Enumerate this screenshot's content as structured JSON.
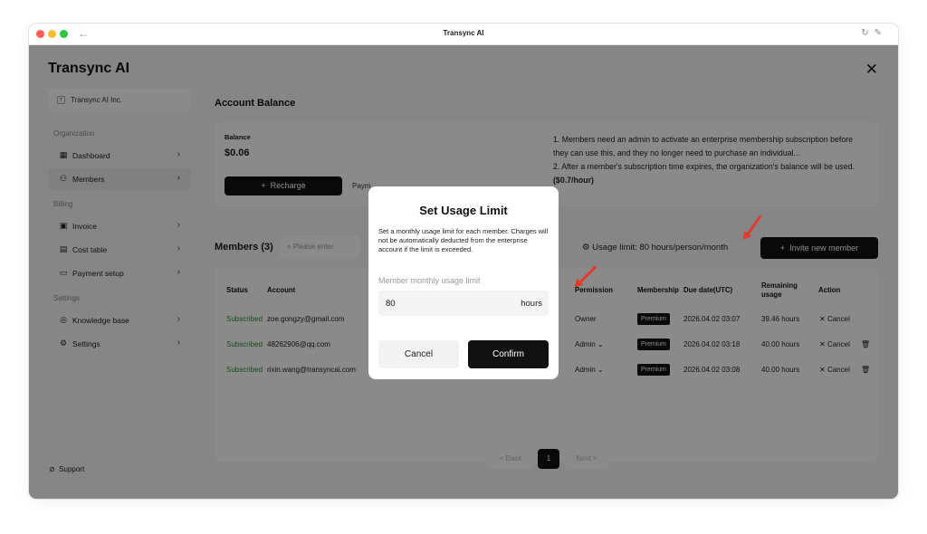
{
  "window": {
    "title": "Transync AI"
  },
  "sidebar": {
    "brand": "Transync AI",
    "org_switcher": {
      "initial": "T",
      "name": "Transync AI Inc."
    },
    "sections": {
      "organization": "Organization",
      "billing": "Billing",
      "settings": "Settings"
    },
    "items": [
      {
        "label": "Dashboard",
        "icon": "dashboard-icon"
      },
      {
        "label": "Members",
        "icon": "members-icon"
      },
      {
        "label": "Invoice",
        "icon": "invoice-icon"
      },
      {
        "label": "Cost table",
        "icon": "calendar-icon"
      },
      {
        "label": "Payment setup",
        "icon": "card-icon"
      },
      {
        "label": "Knowledge base",
        "icon": "bulb-icon"
      },
      {
        "label": "Settings",
        "icon": "gear-icon"
      }
    ],
    "support": "Support"
  },
  "account": {
    "heading": "Account Balance",
    "balance_label": "Balance",
    "balance_value": "$0.06",
    "recharge_label": "Recharge",
    "payment_fragment": "Paym",
    "notes": {
      "line1": "1. Members need an admin to activate an enterprise membership subscription before they can use this, and they no longer need to purchase an individual...",
      "line2_prefix": "2. After a member's subscription time expires, the organization's balance will be used. ",
      "line2_price": "($0.7/hour)"
    }
  },
  "members": {
    "title": "Members (3)",
    "search_placeholder": "Please enter",
    "usage_limit": "Usage limit: 80 hours/person/month",
    "invite_label": "Invite new member",
    "columns": {
      "status": "Status",
      "account": "Account",
      "permission": "Permission",
      "membership": "Membership",
      "due_date": "Due date(UTC)",
      "remaining": "Remaining usage",
      "action": "Action"
    },
    "rows": [
      {
        "status": "Subscribed",
        "account": "zoe.gongzy@gmail.com",
        "permission": "Owner",
        "membership": "Premium",
        "due": "2026.04.02 03:07",
        "remaining": "39.46 hours",
        "action": "Cancel"
      },
      {
        "status": "Subscribed",
        "account": "48262906@qq.com",
        "permission": "Admin",
        "membership": "Premium",
        "due": "2026.04.02 03:18",
        "remaining": "40.00 hours",
        "action": "Cancel"
      },
      {
        "status": "Subscribed",
        "account": "rixin.wang@transyncai.com",
        "permission": "Admin",
        "membership": "Premium",
        "due": "2026.04.02 03:08",
        "remaining": "40.00 hours",
        "action": "Cancel"
      }
    ]
  },
  "pagination": {
    "prev": "< Back",
    "current": "1",
    "next": "Next >"
  },
  "modal": {
    "title": "Set Usage Limit",
    "description": "Set a monthly usage limit for each member. Charges will not be automatically deducted from the enterprise account if the limit is exceeded.",
    "field_label": "Member monthly usage limit",
    "value": "80",
    "unit": "hours",
    "cancel_label": "Cancel",
    "confirm_label": "Confirm"
  },
  "colors": {
    "accent": "#111111",
    "subscribed": "#2e8b3a",
    "annotation_arrow": "#e23a2e"
  }
}
